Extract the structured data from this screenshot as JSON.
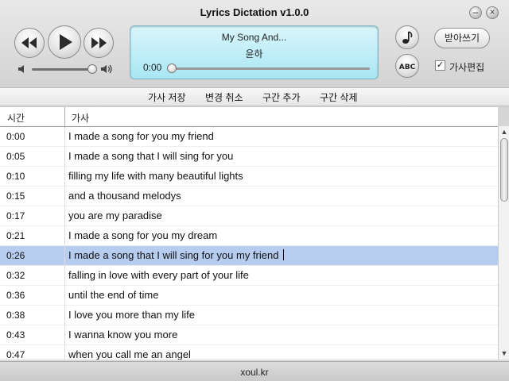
{
  "window": {
    "title": "Lyrics Dictation v1.0.0"
  },
  "player": {
    "song_title": "My Song And...",
    "artist": "윤하",
    "current_time": "0:00",
    "progress": 0.0,
    "volume": 0.9
  },
  "right_panel": {
    "dictation_button": "받아쓰기",
    "edit_lyrics_label": "가사편집",
    "edit_lyrics_checked": true
  },
  "toolbar": {
    "save_label": "가사 저장",
    "undo_label": "변경 취소",
    "add_segment_label": "구간 추가",
    "delete_segment_label": "구간 삭제"
  },
  "table": {
    "columns": [
      "시간",
      "가사"
    ],
    "selected_index": 6,
    "rows": [
      {
        "time": "0:00",
        "lyric": "I made a song for you my friend"
      },
      {
        "time": "0:05",
        "lyric": "I made a song that I will sing for you"
      },
      {
        "time": "0:10",
        "lyric": "filling my life with many beautiful lights"
      },
      {
        "time": "0:15",
        "lyric": "and a thousand melodys"
      },
      {
        "time": "0:17",
        "lyric": "you are my paradise"
      },
      {
        "time": "0:21",
        "lyric": "I made a song for you my dream"
      },
      {
        "time": "0:26",
        "lyric": "I made a song that I will sing for you my friend"
      },
      {
        "time": "0:32",
        "lyric": "falling in love with every part of your life"
      },
      {
        "time": "0:36",
        "lyric": "until the end of time"
      },
      {
        "time": "0:38",
        "lyric": "I love you more than my life"
      },
      {
        "time": "0:43",
        "lyric": "I wanna know you more"
      },
      {
        "time": "0:47",
        "lyric": "when you call me an angel"
      }
    ]
  },
  "status": {
    "text": "xoul.kr"
  }
}
